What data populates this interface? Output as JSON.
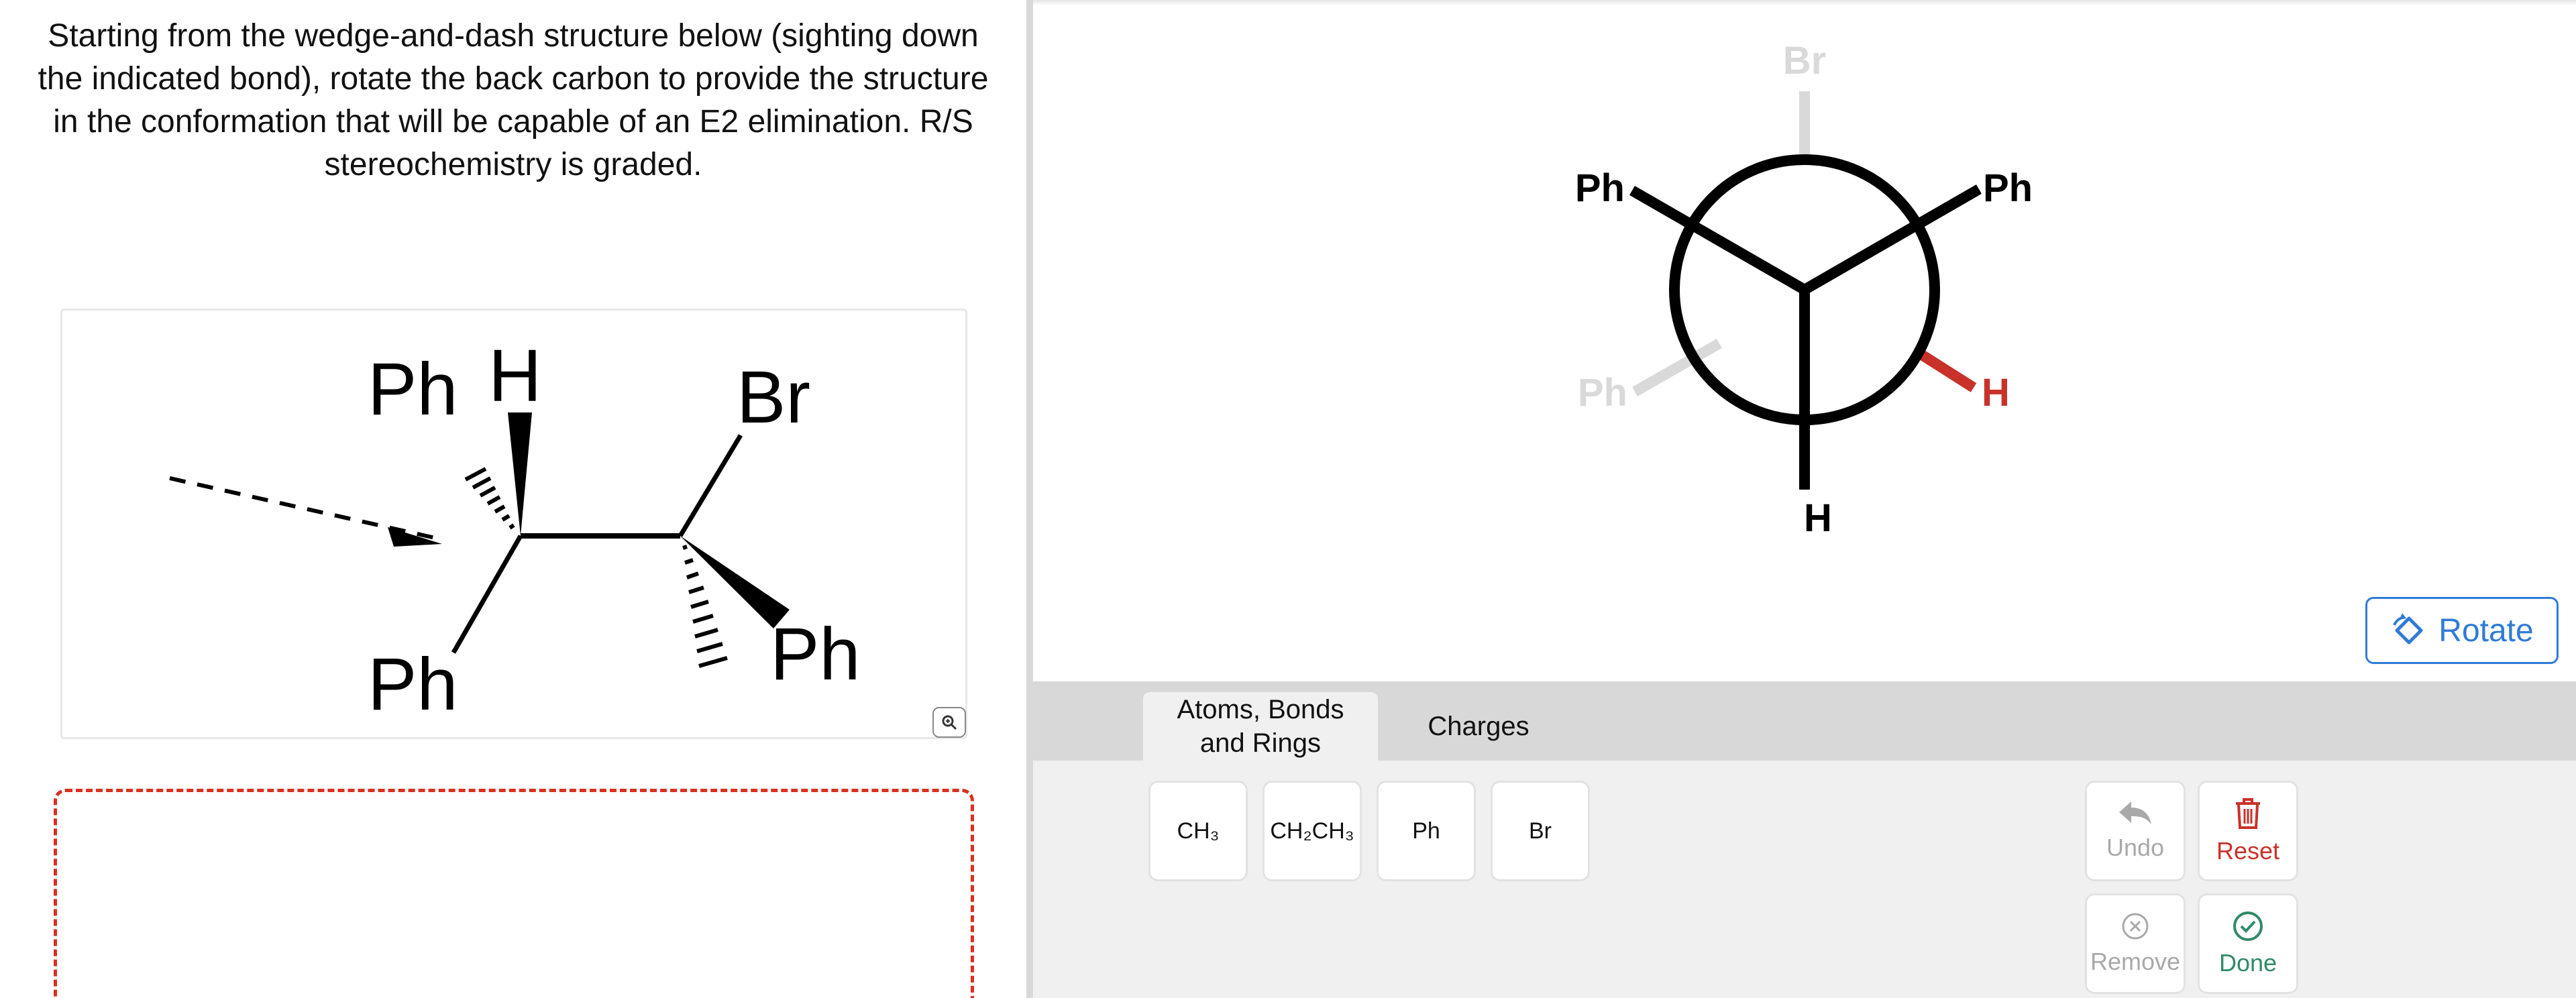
{
  "question": {
    "text": "Starting from the wedge-and-dash structure below (sighting down the indicated bond), rotate the back carbon to provide the structure in the conformation that will be capable of an E2 elimination. R/S stereochemistry is graded."
  },
  "structure": {
    "labels": {
      "ph_top_left": "Ph",
      "h_top": "H",
      "br_top": "Br",
      "ph_bottom_left": "Ph",
      "ph_bottom_right": "Ph"
    }
  },
  "newman": {
    "labels": {
      "br_back": "Br",
      "ph_front_left": "Ph",
      "ph_front_right": "Ph",
      "ph_back_left": "Ph",
      "h_back_right": "H",
      "h_front_bottom": "H"
    },
    "colors": {
      "bond": "#000000",
      "faded": "#d9d9d9",
      "highlight": "#c8322a"
    }
  },
  "rotate_button": {
    "label": "Rotate",
    "icon": "rotate-icon"
  },
  "tabs": [
    {
      "label_line1": "Atoms, Bonds",
      "label_line2": "and Rings"
    },
    {
      "label": "Charges"
    }
  ],
  "tools": [
    {
      "label": "CH₃"
    },
    {
      "label": "CH₂CH₃"
    },
    {
      "label": "Ph"
    },
    {
      "label": "Br"
    }
  ],
  "actions": {
    "undo": {
      "label": "Undo",
      "icon": "undo-icon",
      "color": "#a9a9a9"
    },
    "reset": {
      "label": "Reset",
      "icon": "trash-icon",
      "color": "#c8322a"
    },
    "remove": {
      "label": "Remove",
      "icon": "remove-icon",
      "color": "#a9a9a9"
    },
    "done": {
      "label": "Done",
      "icon": "check-icon",
      "color": "#2f8a68"
    }
  },
  "colors": {
    "answer_border": "#d9301f",
    "accent": "#2f7bd6"
  }
}
